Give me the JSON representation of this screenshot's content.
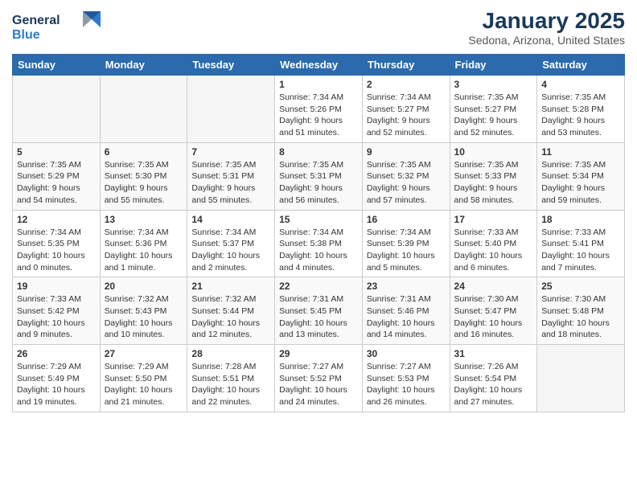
{
  "header": {
    "logo_line1": "General",
    "logo_line2": "Blue",
    "month": "January 2025",
    "location": "Sedona, Arizona, United States"
  },
  "days_of_week": [
    "Sunday",
    "Monday",
    "Tuesday",
    "Wednesday",
    "Thursday",
    "Friday",
    "Saturday"
  ],
  "weeks": [
    [
      {
        "num": "",
        "info": ""
      },
      {
        "num": "",
        "info": ""
      },
      {
        "num": "",
        "info": ""
      },
      {
        "num": "1",
        "info": "Sunrise: 7:34 AM\nSunset: 5:26 PM\nDaylight: 9 hours\nand 51 minutes."
      },
      {
        "num": "2",
        "info": "Sunrise: 7:34 AM\nSunset: 5:27 PM\nDaylight: 9 hours\nand 52 minutes."
      },
      {
        "num": "3",
        "info": "Sunrise: 7:35 AM\nSunset: 5:27 PM\nDaylight: 9 hours\nand 52 minutes."
      },
      {
        "num": "4",
        "info": "Sunrise: 7:35 AM\nSunset: 5:28 PM\nDaylight: 9 hours\nand 53 minutes."
      }
    ],
    [
      {
        "num": "5",
        "info": "Sunrise: 7:35 AM\nSunset: 5:29 PM\nDaylight: 9 hours\nand 54 minutes."
      },
      {
        "num": "6",
        "info": "Sunrise: 7:35 AM\nSunset: 5:30 PM\nDaylight: 9 hours\nand 55 minutes."
      },
      {
        "num": "7",
        "info": "Sunrise: 7:35 AM\nSunset: 5:31 PM\nDaylight: 9 hours\nand 55 minutes."
      },
      {
        "num": "8",
        "info": "Sunrise: 7:35 AM\nSunset: 5:31 PM\nDaylight: 9 hours\nand 56 minutes."
      },
      {
        "num": "9",
        "info": "Sunrise: 7:35 AM\nSunset: 5:32 PM\nDaylight: 9 hours\nand 57 minutes."
      },
      {
        "num": "10",
        "info": "Sunrise: 7:35 AM\nSunset: 5:33 PM\nDaylight: 9 hours\nand 58 minutes."
      },
      {
        "num": "11",
        "info": "Sunrise: 7:35 AM\nSunset: 5:34 PM\nDaylight: 9 hours\nand 59 minutes."
      }
    ],
    [
      {
        "num": "12",
        "info": "Sunrise: 7:34 AM\nSunset: 5:35 PM\nDaylight: 10 hours\nand 0 minutes."
      },
      {
        "num": "13",
        "info": "Sunrise: 7:34 AM\nSunset: 5:36 PM\nDaylight: 10 hours\nand 1 minute."
      },
      {
        "num": "14",
        "info": "Sunrise: 7:34 AM\nSunset: 5:37 PM\nDaylight: 10 hours\nand 2 minutes."
      },
      {
        "num": "15",
        "info": "Sunrise: 7:34 AM\nSunset: 5:38 PM\nDaylight: 10 hours\nand 4 minutes."
      },
      {
        "num": "16",
        "info": "Sunrise: 7:34 AM\nSunset: 5:39 PM\nDaylight: 10 hours\nand 5 minutes."
      },
      {
        "num": "17",
        "info": "Sunrise: 7:33 AM\nSunset: 5:40 PM\nDaylight: 10 hours\nand 6 minutes."
      },
      {
        "num": "18",
        "info": "Sunrise: 7:33 AM\nSunset: 5:41 PM\nDaylight: 10 hours\nand 7 minutes."
      }
    ],
    [
      {
        "num": "19",
        "info": "Sunrise: 7:33 AM\nSunset: 5:42 PM\nDaylight: 10 hours\nand 9 minutes."
      },
      {
        "num": "20",
        "info": "Sunrise: 7:32 AM\nSunset: 5:43 PM\nDaylight: 10 hours\nand 10 minutes."
      },
      {
        "num": "21",
        "info": "Sunrise: 7:32 AM\nSunset: 5:44 PM\nDaylight: 10 hours\nand 12 minutes."
      },
      {
        "num": "22",
        "info": "Sunrise: 7:31 AM\nSunset: 5:45 PM\nDaylight: 10 hours\nand 13 minutes."
      },
      {
        "num": "23",
        "info": "Sunrise: 7:31 AM\nSunset: 5:46 PM\nDaylight: 10 hours\nand 14 minutes."
      },
      {
        "num": "24",
        "info": "Sunrise: 7:30 AM\nSunset: 5:47 PM\nDaylight: 10 hours\nand 16 minutes."
      },
      {
        "num": "25",
        "info": "Sunrise: 7:30 AM\nSunset: 5:48 PM\nDaylight: 10 hours\nand 18 minutes."
      }
    ],
    [
      {
        "num": "26",
        "info": "Sunrise: 7:29 AM\nSunset: 5:49 PM\nDaylight: 10 hours\nand 19 minutes."
      },
      {
        "num": "27",
        "info": "Sunrise: 7:29 AM\nSunset: 5:50 PM\nDaylight: 10 hours\nand 21 minutes."
      },
      {
        "num": "28",
        "info": "Sunrise: 7:28 AM\nSunset: 5:51 PM\nDaylight: 10 hours\nand 22 minutes."
      },
      {
        "num": "29",
        "info": "Sunrise: 7:27 AM\nSunset: 5:52 PM\nDaylight: 10 hours\nand 24 minutes."
      },
      {
        "num": "30",
        "info": "Sunrise: 7:27 AM\nSunset: 5:53 PM\nDaylight: 10 hours\nand 26 minutes."
      },
      {
        "num": "31",
        "info": "Sunrise: 7:26 AM\nSunset: 5:54 PM\nDaylight: 10 hours\nand 27 minutes."
      },
      {
        "num": "",
        "info": ""
      }
    ]
  ]
}
